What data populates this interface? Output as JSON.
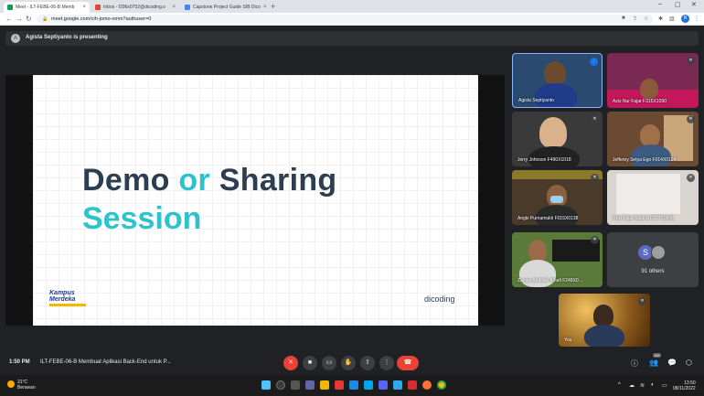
{
  "browser": {
    "tabs": [
      {
        "label": "Meet - ILT-FEBE-06-B Memb",
        "active": true,
        "favicon_color": "#0f9d58"
      },
      {
        "label": "Inbox - f296x0752@dicoding.o",
        "active": false,
        "favicon_color": "#ea4335"
      },
      {
        "label": "Capstone Project Guide SIB Dico",
        "active": false,
        "favicon_color": "#4285f4"
      }
    ],
    "url": "meet.google.com/cih-jomo-omm?authuser=0",
    "profile_initial": "R"
  },
  "presenter_banner": {
    "avatar_initial": "A",
    "text": "Agista Septiyanto is presenting"
  },
  "slide": {
    "title_part1": "Demo",
    "title_or": "or",
    "title_part2": "Sharing",
    "title_line2": "Session",
    "logo_left_line1": "Kampus",
    "logo_left_line2": "Merdeka",
    "logo_right": "dicoding"
  },
  "participants": [
    {
      "name": "Agista Septiyanto",
      "bg": "#2b4a6f"
    },
    {
      "name": "Aziz Nur Fajar F315X1090",
      "bg": "#7a2a52"
    },
    {
      "name": "Jerry Johnson F490X1018",
      "bg": "#3a3a3a"
    },
    {
      "name": "Jefferey Setya Ego F014X0124",
      "bg": "#6b4a33"
    },
    {
      "name": "Angki Purnamukti F015X0138",
      "bg": "#4a3a2a"
    },
    {
      "name": "Rezi Fajar Sukma F277X0648",
      "bg": "#d9d4cf"
    },
    {
      "name": "Zainan Abdillah Alhafi F248X0…",
      "bg": "#5a7a3a"
    },
    {
      "name": "91 others",
      "bg": "#3c4043"
    },
    {
      "name": "You",
      "bg": "#8a5a1a"
    }
  ],
  "others_avatar_initial": "S",
  "meeting": {
    "time": "1:50 PM",
    "title": "ILT-FEBE-06-B Membuat Aplikasi Back-End untuk P...",
    "participant_count": "100"
  },
  "taskbar": {
    "weather_temp": "31°C",
    "weather_location": "Berawan",
    "clock_time": "13:50",
    "clock_date": "08/11/2022"
  }
}
